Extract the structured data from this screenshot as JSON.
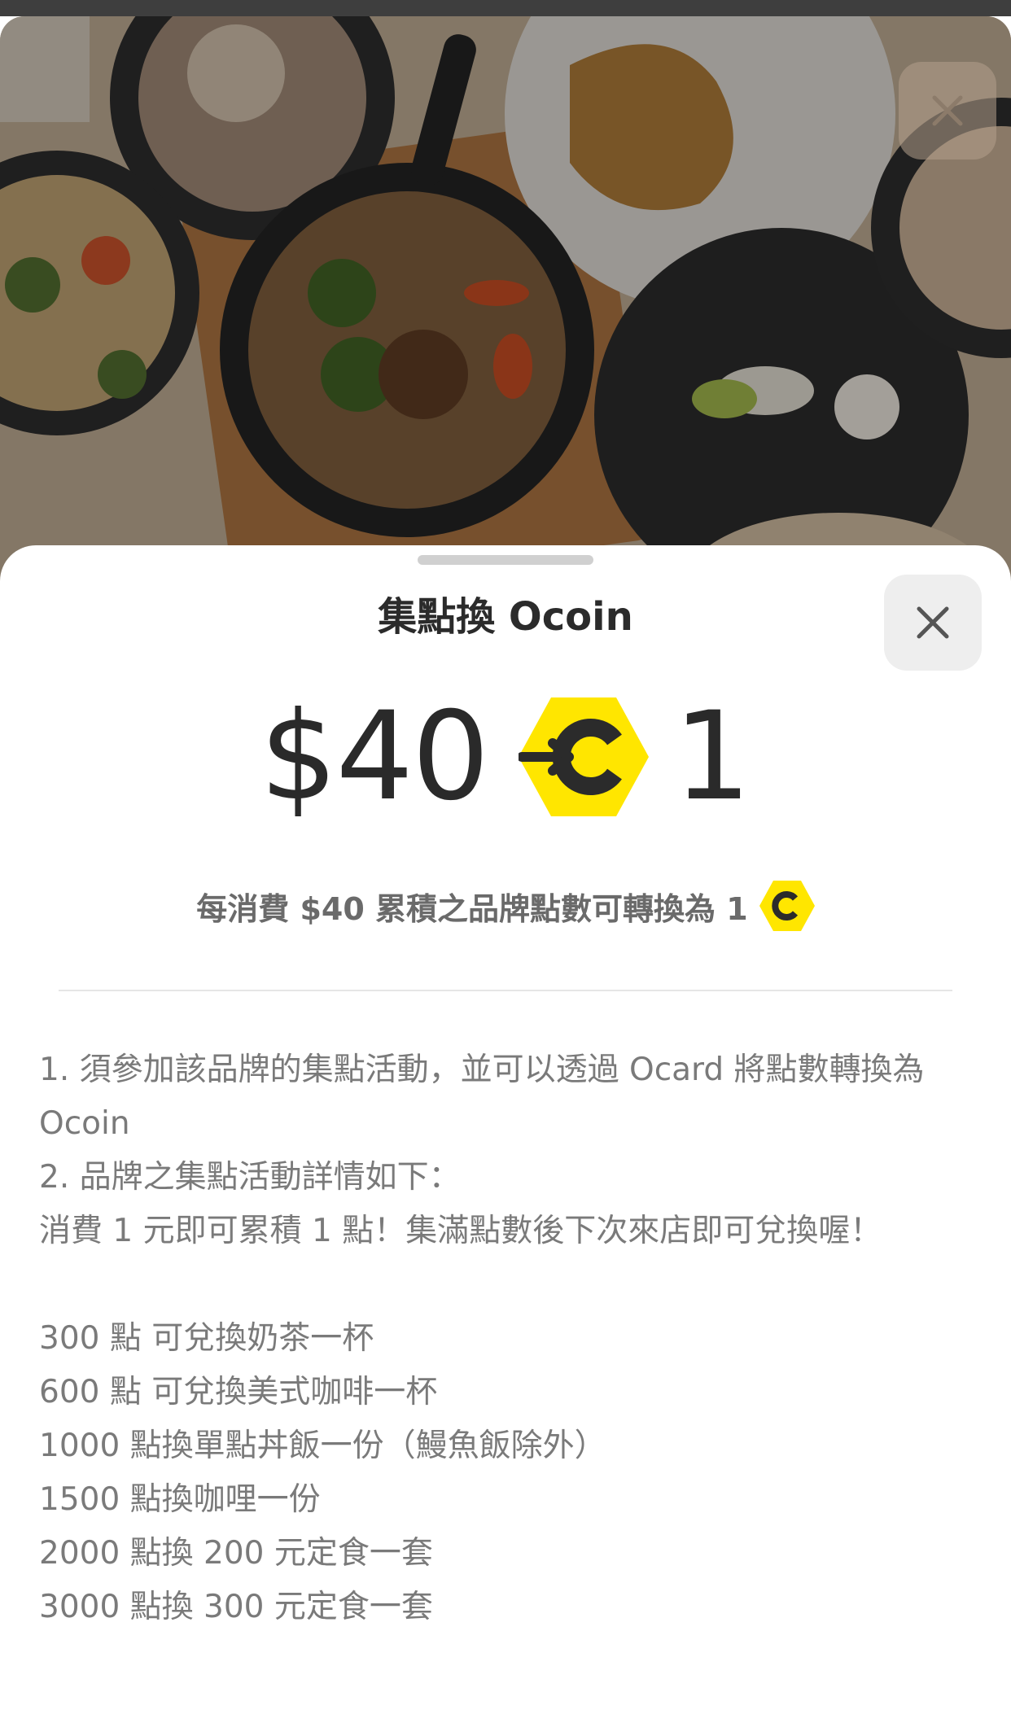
{
  "sheet": {
    "title": "集點換 Ocoin",
    "close_icon": "close-icon",
    "rate": {
      "amount": "$40",
      "icon": "ocoin-convert-icon",
      "coins": "1"
    },
    "description": "每消費 $40 累積之品牌點數可轉換為 1",
    "description_icon": "ocoin-icon",
    "rules": {
      "line1": "1. 須參加該品牌的集點活動，並可以透過 Ocard 將點數轉換為 Ocoin",
      "line2": "2. 品牌之集點活動詳情如下：",
      "line3": "消費 1 元即可累積 1 點！集滿點數後下次來店即可兌換喔！",
      "tiers": [
        "300 點 可兌換奶茶一杯",
        "600 點 可兌換美式咖啡一杯",
        "1000 點換單點丼飯一份（鰻魚飯除外）",
        "1500 點換咖哩一份",
        "2000 點換 200 元定食一套",
        "3000 點換 300 元定食一套"
      ]
    }
  },
  "colors": {
    "ocoin_yellow": "#FFE600",
    "ocoin_dark": "#2b2b2b"
  }
}
